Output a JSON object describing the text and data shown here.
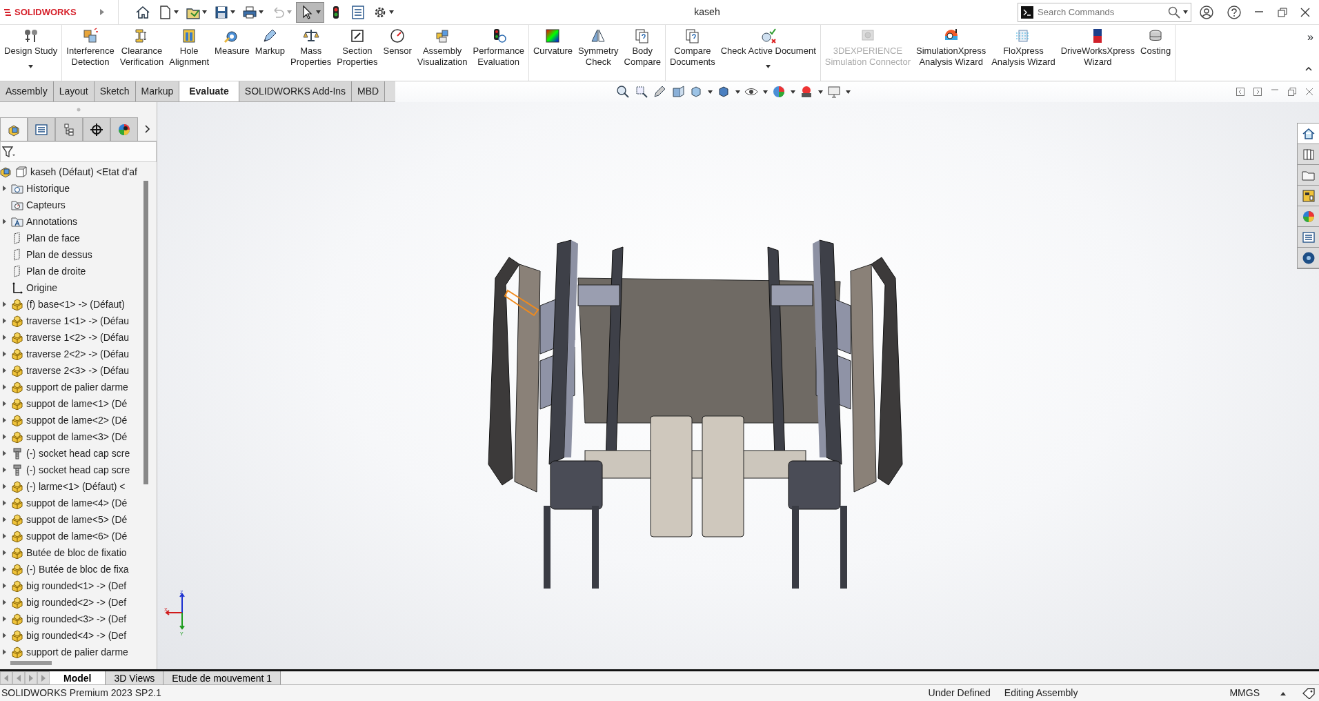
{
  "app": {
    "logo": "SOLIDWORKS"
  },
  "window": {
    "title": "kaseh"
  },
  "quick_access": [
    {
      "kind": "home",
      "dropdown": false,
      "disabled": false,
      "pressed": false
    },
    {
      "kind": "new",
      "dropdown": true,
      "disabled": false,
      "pressed": false
    },
    {
      "kind": "open",
      "dropdown": true,
      "disabled": false,
      "pressed": false
    },
    {
      "kind": "save",
      "dropdown": true,
      "disabled": false,
      "pressed": false
    },
    {
      "kind": "print",
      "dropdown": true,
      "disabled": false,
      "pressed": false
    },
    {
      "kind": "undo",
      "dropdown": true,
      "disabled": true,
      "pressed": false
    },
    {
      "kind": "select",
      "dropdown": true,
      "disabled": false,
      "pressed": true
    },
    {
      "kind": "rebuild",
      "dropdown": false,
      "disabled": false,
      "pressed": false
    },
    {
      "kind": "file-properties",
      "dropdown": false,
      "disabled": false,
      "pressed": false
    },
    {
      "kind": "options",
      "dropdown": true,
      "disabled": false,
      "pressed": false
    }
  ],
  "search": {
    "placeholder": "Search Commands"
  },
  "ribbon": {
    "groups": [
      [
        {
          "lines": [
            "Design Study"
          ],
          "dropdown": true,
          "disabled": false
        }
      ],
      [
        {
          "lines": [
            "Interference",
            "Detection"
          ],
          "dropdown": false,
          "disabled": false
        },
        {
          "lines": [
            "Clearance",
            "Verification"
          ],
          "dropdown": false,
          "disabled": false
        },
        {
          "lines": [
            "Hole",
            "Alignment"
          ],
          "dropdown": false,
          "disabled": false
        },
        {
          "lines": [
            "Measure"
          ],
          "dropdown": false,
          "disabled": false
        },
        {
          "lines": [
            "Markup"
          ],
          "dropdown": false,
          "disabled": false
        },
        {
          "lines": [
            "Mass",
            "Properties"
          ],
          "dropdown": false,
          "disabled": false
        },
        {
          "lines": [
            "Section",
            "Properties"
          ],
          "dropdown": false,
          "disabled": false
        },
        {
          "lines": [
            "Sensor"
          ],
          "dropdown": false,
          "disabled": false
        },
        {
          "lines": [
            "Assembly",
            "Visualization"
          ],
          "dropdown": false,
          "disabled": false
        },
        {
          "lines": [
            "Performance",
            "Evaluation"
          ],
          "dropdown": false,
          "disabled": false
        }
      ],
      [
        {
          "lines": [
            "Curvature"
          ],
          "dropdown": false,
          "disabled": false
        },
        {
          "lines": [
            "Symmetry",
            "Check"
          ],
          "dropdown": false,
          "disabled": false
        },
        {
          "lines": [
            "Body",
            "Compare"
          ],
          "dropdown": false,
          "disabled": false
        }
      ],
      [
        {
          "lines": [
            "Compare",
            "Documents"
          ],
          "dropdown": false,
          "disabled": false
        },
        {
          "lines": [
            "Check Active Document"
          ],
          "dropdown": true,
          "disabled": false
        }
      ],
      [
        {
          "lines": [
            "3DEXPERIENCE",
            "Simulation Connector"
          ],
          "dropdown": false,
          "disabled": true
        },
        {
          "lines": [
            "SimulationXpress",
            "Analysis Wizard"
          ],
          "dropdown": false,
          "disabled": false
        },
        {
          "lines": [
            "FloXpress",
            "Analysis Wizard"
          ],
          "dropdown": false,
          "disabled": false
        },
        {
          "lines": [
            "DriveWorksXpress",
            "Wizard"
          ],
          "dropdown": false,
          "disabled": false
        },
        {
          "lines": [
            "Costing"
          ],
          "dropdown": false,
          "disabled": false
        }
      ]
    ],
    "overflow": "»"
  },
  "tabs": [
    {
      "label": "Assembly",
      "selected": false
    },
    {
      "label": "Layout",
      "selected": false
    },
    {
      "label": "Sketch",
      "selected": false
    },
    {
      "label": "Markup",
      "selected": false
    },
    {
      "label": "Evaluate",
      "selected": true
    },
    {
      "label": "SOLIDWORKS Add-Ins",
      "selected": false
    },
    {
      "label": "MBD",
      "selected": false
    }
  ],
  "panel_tabs": [
    {
      "kind": "feature",
      "selected": true
    },
    {
      "kind": "property",
      "selected": false
    },
    {
      "kind": "config",
      "selected": false
    },
    {
      "kind": "dimxpert",
      "selected": false
    },
    {
      "kind": "display",
      "selected": false
    }
  ],
  "feature_tree": {
    "label": "kaseh (Défaut) <Etat d'af",
    "children": [
      {
        "label": "Historique",
        "kind": "history",
        "expandable": true
      },
      {
        "label": "Capteurs",
        "kind": "sensors",
        "expandable": false
      },
      {
        "label": "Annotations",
        "kind": "annotations",
        "expandable": true
      },
      {
        "label": "Plan de face",
        "kind": "plane",
        "expandable": false
      },
      {
        "label": "Plan de dessus",
        "kind": "plane",
        "expandable": false
      },
      {
        "label": "Plan de droite",
        "kind": "plane",
        "expandable": false
      },
      {
        "label": "Origine",
        "kind": "origin",
        "expandable": false
      },
      {
        "label": "(f) base<1> -> (Défaut)",
        "kind": "part",
        "expandable": true
      },
      {
        "label": "traverse 1<1> -> (Défau",
        "kind": "part",
        "expandable": true
      },
      {
        "label": "traverse 1<2> -> (Défau",
        "kind": "part",
        "expandable": true
      },
      {
        "label": "traverse 2<2> -> (Défau",
        "kind": "part",
        "expandable": true
      },
      {
        "label": "traverse 2<3> -> (Défau",
        "kind": "part",
        "expandable": true
      },
      {
        "label": "support de palier darme",
        "kind": "part",
        "expandable": true
      },
      {
        "label": "suppot de lame<1> (Dé",
        "kind": "part",
        "expandable": true
      },
      {
        "label": "suppot de lame<2> (Dé",
        "kind": "part",
        "expandable": true
      },
      {
        "label": "suppot de lame<3> (Dé",
        "kind": "part",
        "expandable": true
      },
      {
        "label": "(-) socket head cap scre",
        "kind": "screw",
        "expandable": true
      },
      {
        "label": "(-) socket head cap scre",
        "kind": "screw",
        "expandable": true
      },
      {
        "label": "(-) larme<1> (Défaut) <",
        "kind": "part",
        "expandable": true
      },
      {
        "label": "suppot de lame<4> (Dé",
        "kind": "part",
        "expandable": true
      },
      {
        "label": "suppot de lame<5> (Dé",
        "kind": "part",
        "expandable": true
      },
      {
        "label": "suppot de lame<6> (Dé",
        "kind": "part",
        "expandable": true
      },
      {
        "label": "Butée de bloc de fixatio",
        "kind": "part",
        "expandable": true
      },
      {
        "label": "(-) Butée de bloc de fixa",
        "kind": "part",
        "expandable": true
      },
      {
        "label": "big rounded<1> -> (Def",
        "kind": "part",
        "expandable": true
      },
      {
        "label": "big rounded<2> -> (Def",
        "kind": "part",
        "expandable": true
      },
      {
        "label": "big rounded<3> -> (Def",
        "kind": "part",
        "expandable": true
      },
      {
        "label": "big rounded<4> -> (Def",
        "kind": "part",
        "expandable": true
      },
      {
        "label": "support de palier darme",
        "kind": "part",
        "expandable": true
      }
    ]
  },
  "task_pane": [
    {
      "kind": "home",
      "selected": true
    },
    {
      "kind": "library",
      "selected": false
    },
    {
      "kind": "explorer",
      "selected": false
    },
    {
      "kind": "palette",
      "selected": false
    },
    {
      "kind": "appearance",
      "selected": false
    },
    {
      "kind": "properties",
      "selected": false
    },
    {
      "kind": "forum",
      "selected": false
    }
  ],
  "triad": {
    "labels": [
      "Z",
      "X",
      "Y"
    ]
  },
  "bottom_tabs": [
    {
      "label": "Model",
      "selected": true
    },
    {
      "label": "3D Views",
      "selected": false
    },
    {
      "label": "Etude de mouvement 1",
      "selected": false
    }
  ],
  "status_bar": {
    "product": "SOLIDWORKS Premium 2023 SP2.1",
    "state": "Under Defined",
    "mode": "Editing Assembly",
    "units": "MMGS"
  }
}
